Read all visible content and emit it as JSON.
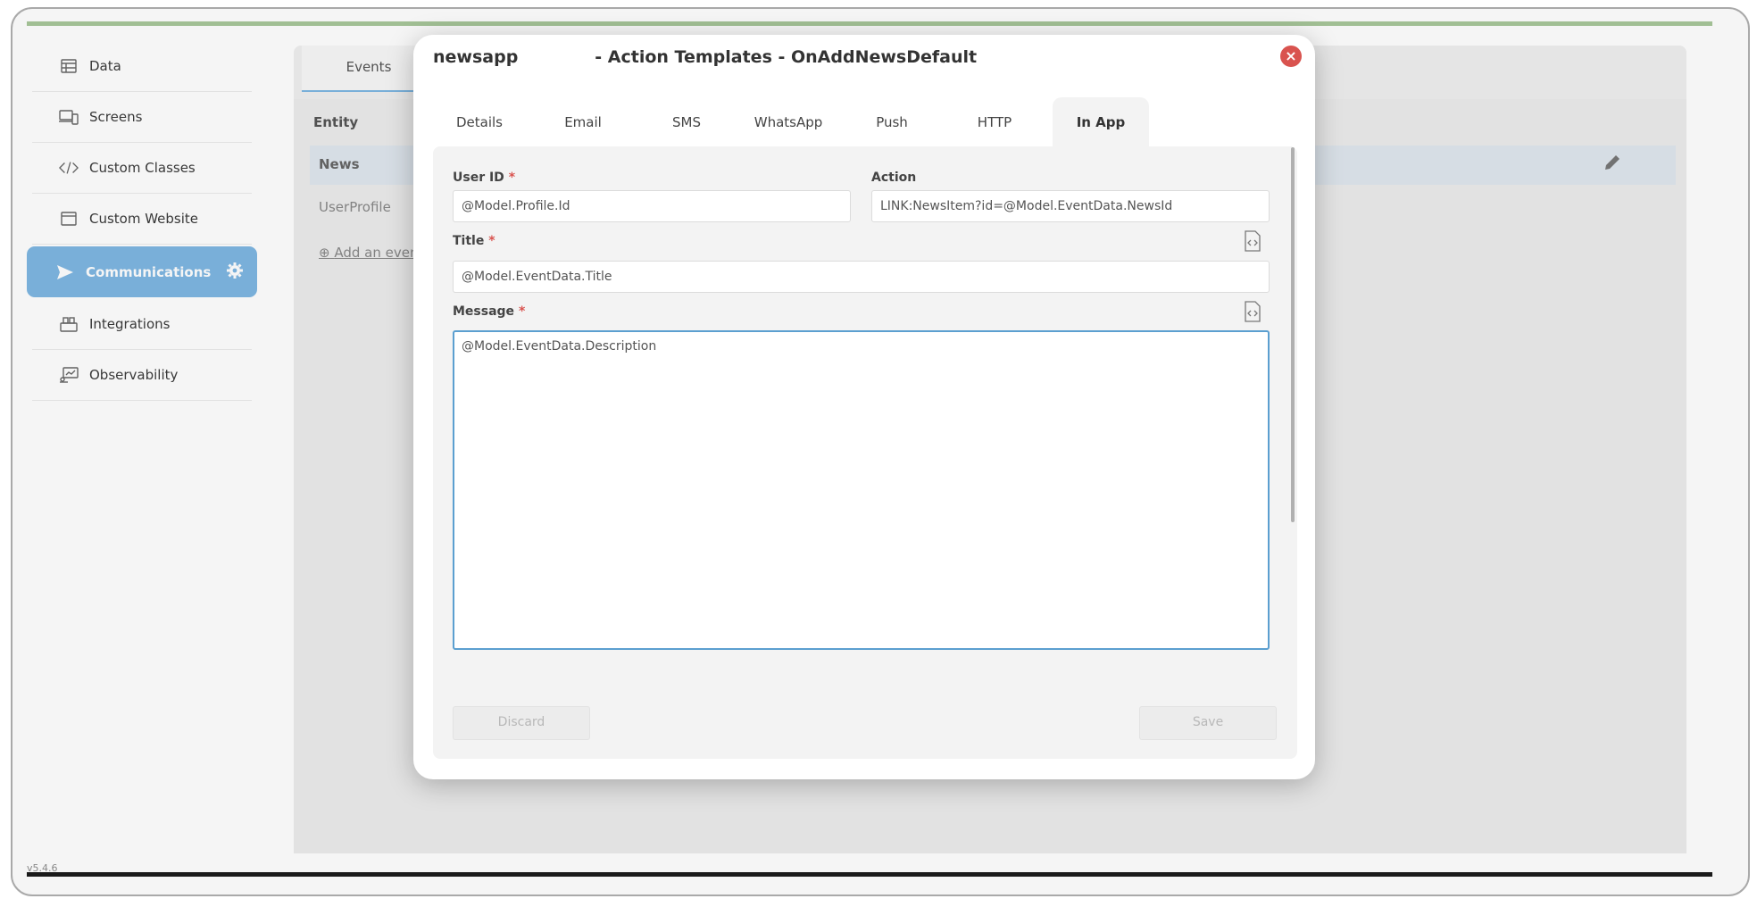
{
  "version": "v5.4.6",
  "sidebar": {
    "items": [
      {
        "label": "Data",
        "icon": "table-icon"
      },
      {
        "label": "Screens",
        "icon": "devices-icon"
      },
      {
        "label": "Custom Classes",
        "icon": "code-icon"
      },
      {
        "label": "Custom Website",
        "icon": "browser-icon"
      },
      {
        "label": "Communications",
        "icon": "send-icon",
        "active": true
      },
      {
        "label": "Integrations",
        "icon": "integrations-icon"
      },
      {
        "label": "Observability",
        "icon": "monitor-chart-icon"
      }
    ]
  },
  "background": {
    "tab_label": "Events",
    "column_header": "Entity",
    "rows": [
      "News",
      "UserProfile"
    ],
    "add_event_label": "Add an event"
  },
  "modal": {
    "title": "newsapp             - Action Templates - OnAddNewsDefault",
    "tabs": [
      "Details",
      "Email",
      "SMS",
      "WhatsApp",
      "Push",
      "HTTP",
      "In App"
    ],
    "active_tab": "In App",
    "fields": {
      "user_id_label": "User ID",
      "user_id_value": "@Model.Profile.Id",
      "action_label": "Action",
      "action_value": "LINK:NewsItem?id=@Model.EventData.NewsId",
      "title_label": "Title",
      "title_value": "@Model.EventData.Title",
      "message_label": "Message",
      "message_value": "@Model.EventData.Description"
    },
    "required_mark": "*",
    "discard_label": "Discard",
    "save_label": "Save"
  },
  "colors": {
    "accent": "#7eb7e2",
    "active_tab_underline": "#4a90c8",
    "close": "#d9534f",
    "top_bar": "#a8c79b"
  }
}
